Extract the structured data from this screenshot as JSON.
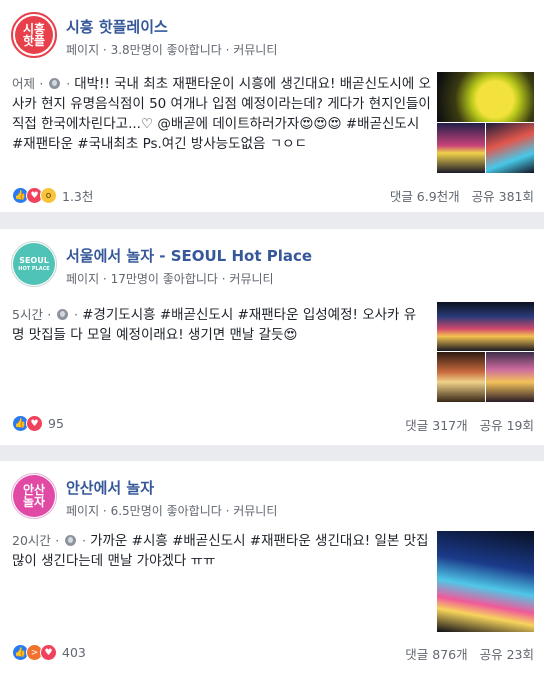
{
  "posts": [
    {
      "avatar_text": [
        "시흥",
        "핫플"
      ],
      "page_name": "시흥 핫플레이스",
      "meta": "페이지 · 3.8만명이 좋아합니다 · 커뮤니티",
      "time": "어제",
      "text": "대박!! 국내 최초 재팬타운이 시흥에 생긴대요! 배곧신도시에 오사카 현지 유명음식점이 50 여개나 입점 예정이라는데? 게다가 현지인들이 직접 한국에차린다고...♡ @배곧에 데이트하러가자😍😍😍 #배곧신도시 #재팬타운 #국내최초 Ps.여긴 방사능도없음 ㄱㅇㄷ",
      "reaction_icons": [
        "like-icon",
        "love-icon",
        "wow-icon"
      ],
      "reaction_count": "1.3천",
      "comments": "댓글 6.9천개",
      "shares": "공유 381회"
    },
    {
      "avatar_text": [
        "SEOUL",
        "HOT PLACE"
      ],
      "page_name": "서울에서 놀자 - SEOUL Hot Place",
      "meta": "페이지 · 17만명이 좋아합니다 · 커뮤니티",
      "time": "5시간",
      "text": "#경기도시흥 #배곧신도시 #재팬타운 입성예정! 오사카 유명 맛집들 다 모일 예정이래요! 생기면 맨날 갈듯😍",
      "reaction_icons": [
        "like-icon",
        "love-icon"
      ],
      "reaction_count": "95",
      "comments": "댓글 317개",
      "shares": "공유 19회"
    },
    {
      "avatar_text": [
        "안산",
        "놀자"
      ],
      "page_name": "안산에서 놀자",
      "meta": "페이지 · 6.5만명이 좋아합니다 · 커뮤니티",
      "time": "20시간",
      "text": "가까운 #시흥 #배곧신도시 #재팬타운 생긴대요! 일본 맛집 많이 생긴다는데 맨날 가야겠다 ㅠㅠ",
      "reaction_icons": [
        "like-icon",
        "angry-icon",
        "love-icon"
      ],
      "reaction_count": "403",
      "comments": "댓글 876개",
      "shares": "공유 23회"
    }
  ]
}
